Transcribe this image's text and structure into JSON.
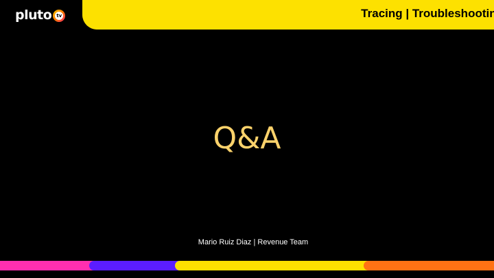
{
  "header": {
    "logo_text": "pluto",
    "logo_badge": "tv",
    "title": "Tracing | Troubleshooting"
  },
  "main": {
    "title": "Q&A"
  },
  "footer": {
    "caption": "Mario Ruiz Diaz | Revenue Team"
  },
  "colors": {
    "background": "#000000",
    "banner": "#fde100",
    "title_text": "#fcd26b",
    "stripe": [
      "#ff2fb0",
      "#5b1dff",
      "#fde100",
      "#ff7214"
    ]
  }
}
